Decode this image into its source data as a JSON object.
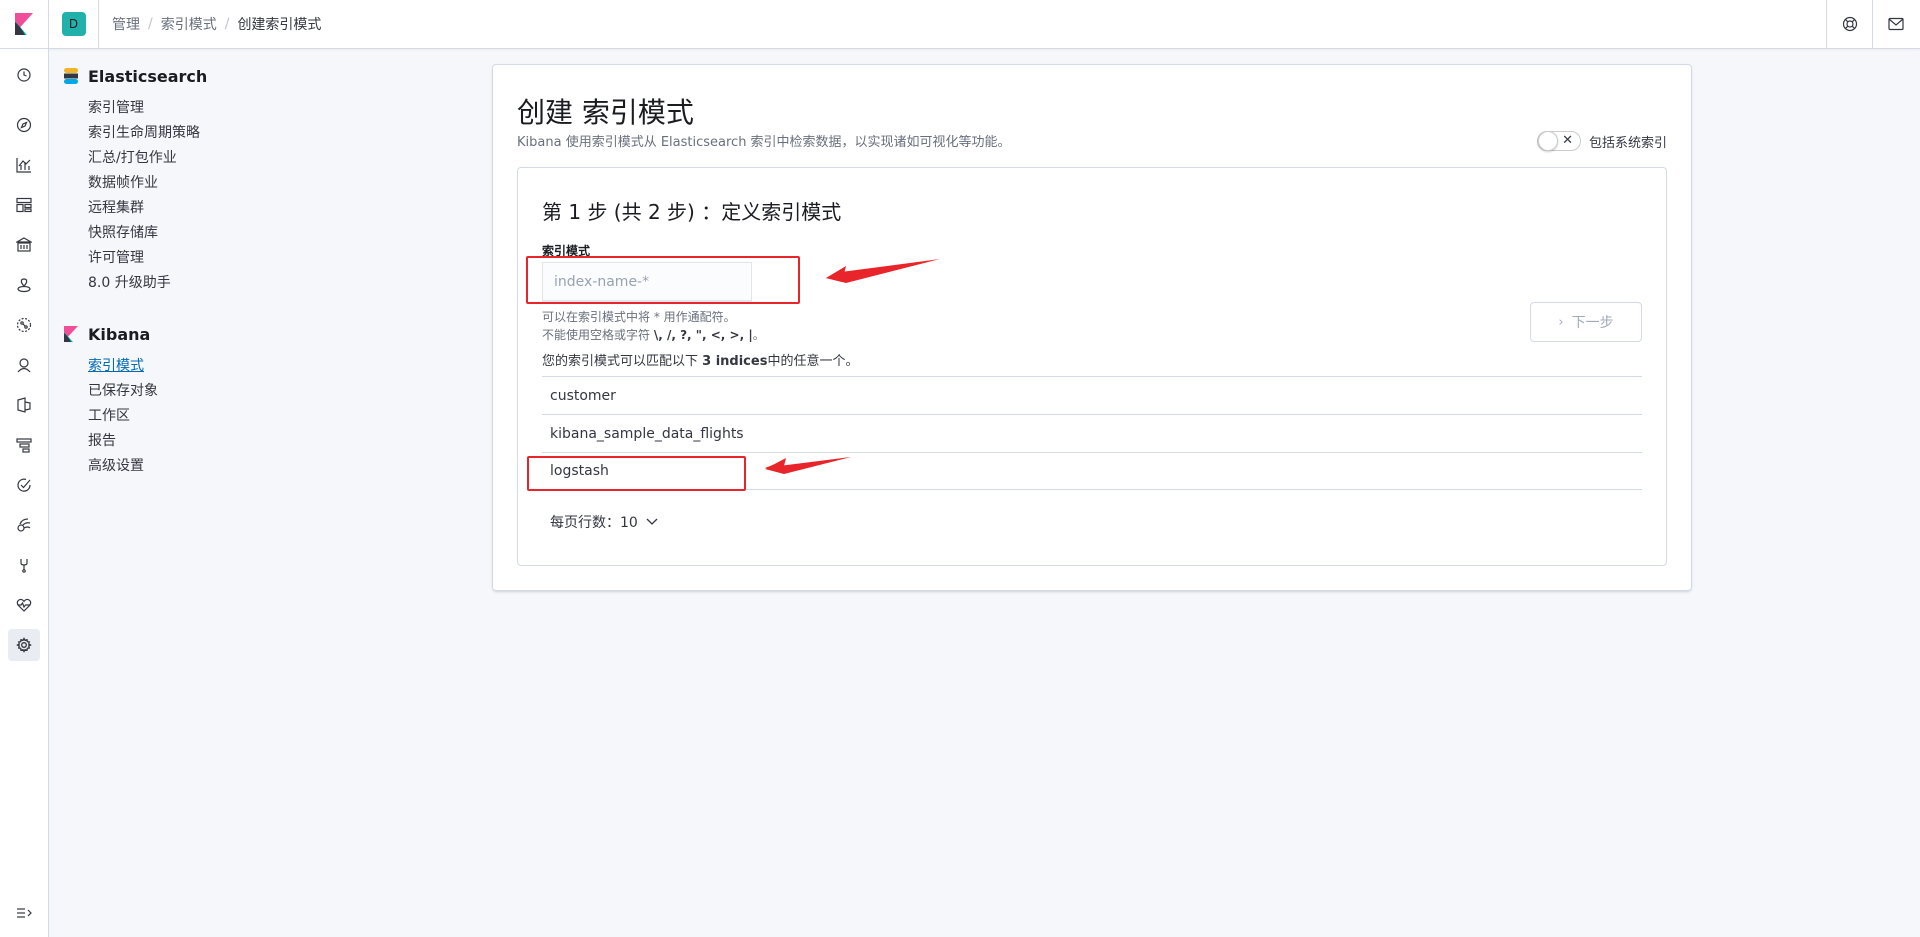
{
  "header": {
    "space_initial": "D",
    "breadcrumbs": [
      "管理",
      "索引模式",
      "创建索引模式"
    ]
  },
  "sidebar": {
    "groups": [
      {
        "title": "Elasticsearch",
        "items": [
          "索引管理",
          "索引生命周期策略",
          "汇总/打包作业",
          "数据帧作业",
          "远程集群",
          "快照存储库",
          "许可管理",
          "8.0 升级助手"
        ]
      },
      {
        "title": "Kibana",
        "items": [
          "索引模式",
          "已保存对象",
          "工作区",
          "报告",
          "高级设置"
        ],
        "selected_index": 0
      }
    ]
  },
  "main": {
    "title": "创建 索引模式",
    "description": "Kibana 使用索引模式从 Elasticsearch 索引中检索数据，以实现诸如可视化等功能。",
    "toggle_label": "包括系统索引",
    "toggle_on": false,
    "step_title": "第 1 步 (共 2 步) ：定义索引模式",
    "field_label": "索引模式",
    "input_value": "",
    "input_placeholder": "index-name-*",
    "help_line1": "可以在索引模式中将 * 用作通配符。",
    "help_line2_prefix": "不能使用空格或字符 ",
    "help_line2_chars": "\\, /, ?, \", <, >, |",
    "help_line2_suffix": "。",
    "next_button": "下一步",
    "match_prefix": "您的索引模式可以匹配以下 ",
    "match_count": "3 indices",
    "match_suffix": "中的任意一个。",
    "indices": [
      "customer",
      "kibana_sample_data_flights",
      "logstash"
    ],
    "rows_per_page": "每页行数：10"
  },
  "colors": {
    "accent": "#006bb4",
    "annotation_red": "#e8252a",
    "space_avatar": "#20b2aa"
  }
}
